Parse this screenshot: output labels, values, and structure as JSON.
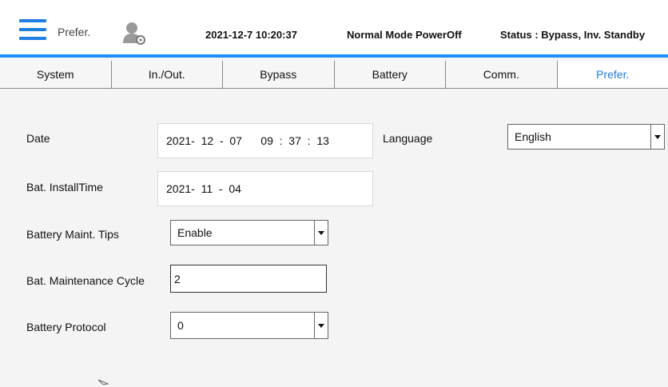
{
  "header": {
    "title": "Prefer.",
    "datetime": "2021-12-7 10:20:37",
    "mode": "Normal Mode  PowerOff",
    "status": "Status : Bypass, Inv. Standby"
  },
  "tabs": [
    {
      "label": "System",
      "active": false
    },
    {
      "label": "In./Out.",
      "active": false
    },
    {
      "label": "Bypass",
      "active": false
    },
    {
      "label": "Battery",
      "active": false
    },
    {
      "label": "Comm.",
      "active": false
    },
    {
      "label": "Prefer.",
      "active": true
    }
  ],
  "form": {
    "date": {
      "label": "Date",
      "value": "2021-  12  -  07      09  :  37  :  13"
    },
    "install_time": {
      "label": "Bat. InstallTime",
      "value": "2021-  11  -  04"
    },
    "maint_tips": {
      "label": "Battery Maint. Tips",
      "value": "Enable"
    },
    "maint_cycle": {
      "label": "Bat. Maintenance Cycle",
      "value": "2"
    },
    "protocol": {
      "label": "Battery Protocol",
      "value": "0"
    },
    "language": {
      "label": "Language",
      "value": "English"
    }
  },
  "colors": {
    "accent": "#1e90ff",
    "active_tab_text": "#1e7fe0",
    "background": "#f4f4f4"
  },
  "icons": [
    "menu-icon",
    "user-settings-icon",
    "dropdown-arrow-icon",
    "cursor-icon"
  ]
}
